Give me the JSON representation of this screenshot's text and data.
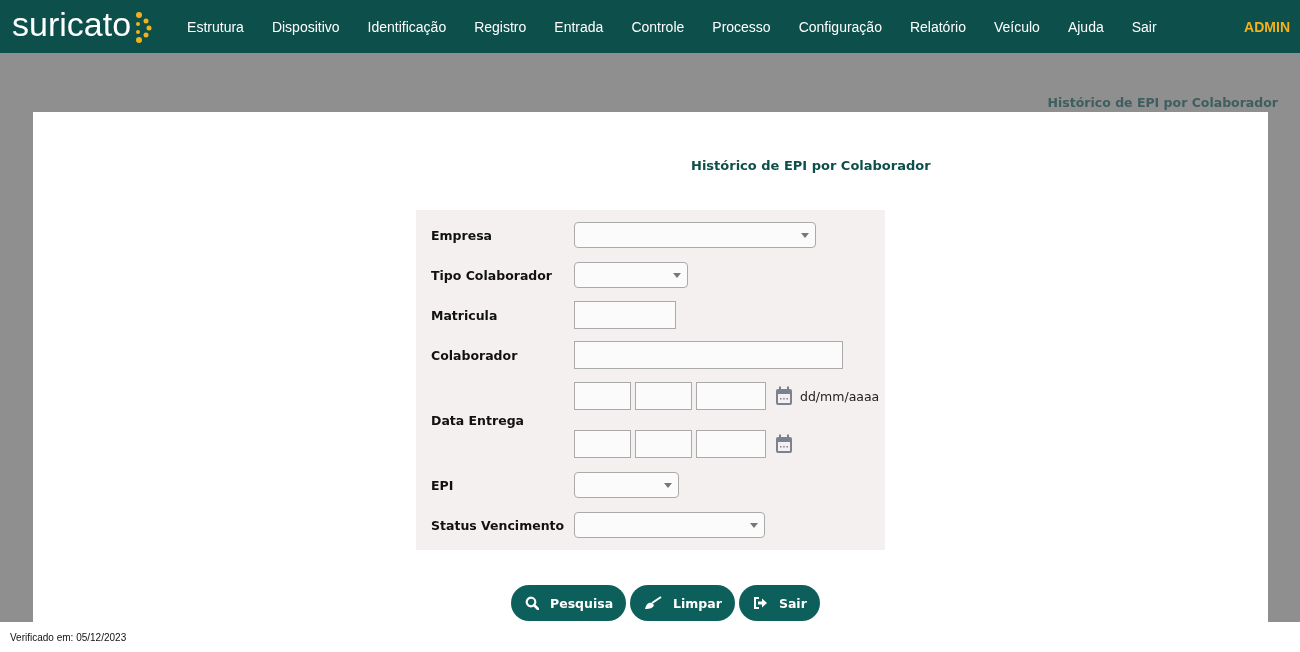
{
  "nav": {
    "logo": "suricato",
    "items": [
      "Estrutura",
      "Dispositivo",
      "Identificação",
      "Registro",
      "Entrada",
      "Controle",
      "Processo",
      "Configuração",
      "Relatório",
      "Veículo",
      "Ajuda",
      "Sair"
    ],
    "user": "ADMIN"
  },
  "breadcrumb": "Histórico de EPI por Colaborador",
  "form": {
    "title": "Histórico de EPI por Colaborador",
    "fields": [
      {
        "label": "Empresa",
        "kind": "select"
      },
      {
        "label": "Tipo Colaborador",
        "kind": "select"
      },
      {
        "label": "Matricula",
        "kind": "text"
      },
      {
        "label": "Colaborador",
        "kind": "text"
      },
      {
        "label": "Data Entrega",
        "kind": "daterange",
        "hint": "dd/mm/aaaa"
      },
      {
        "label": "EPI",
        "kind": "select"
      },
      {
        "label": "Status Vencimento",
        "kind": "select"
      }
    ]
  },
  "buttons": [
    {
      "label": "Pesquisa",
      "kind": "search"
    },
    {
      "label": "Limpar",
      "kind": "clear"
    },
    {
      "label": "Sair",
      "kind": "exit"
    }
  ],
  "footer": "Verificado em: 05/12/2023"
}
